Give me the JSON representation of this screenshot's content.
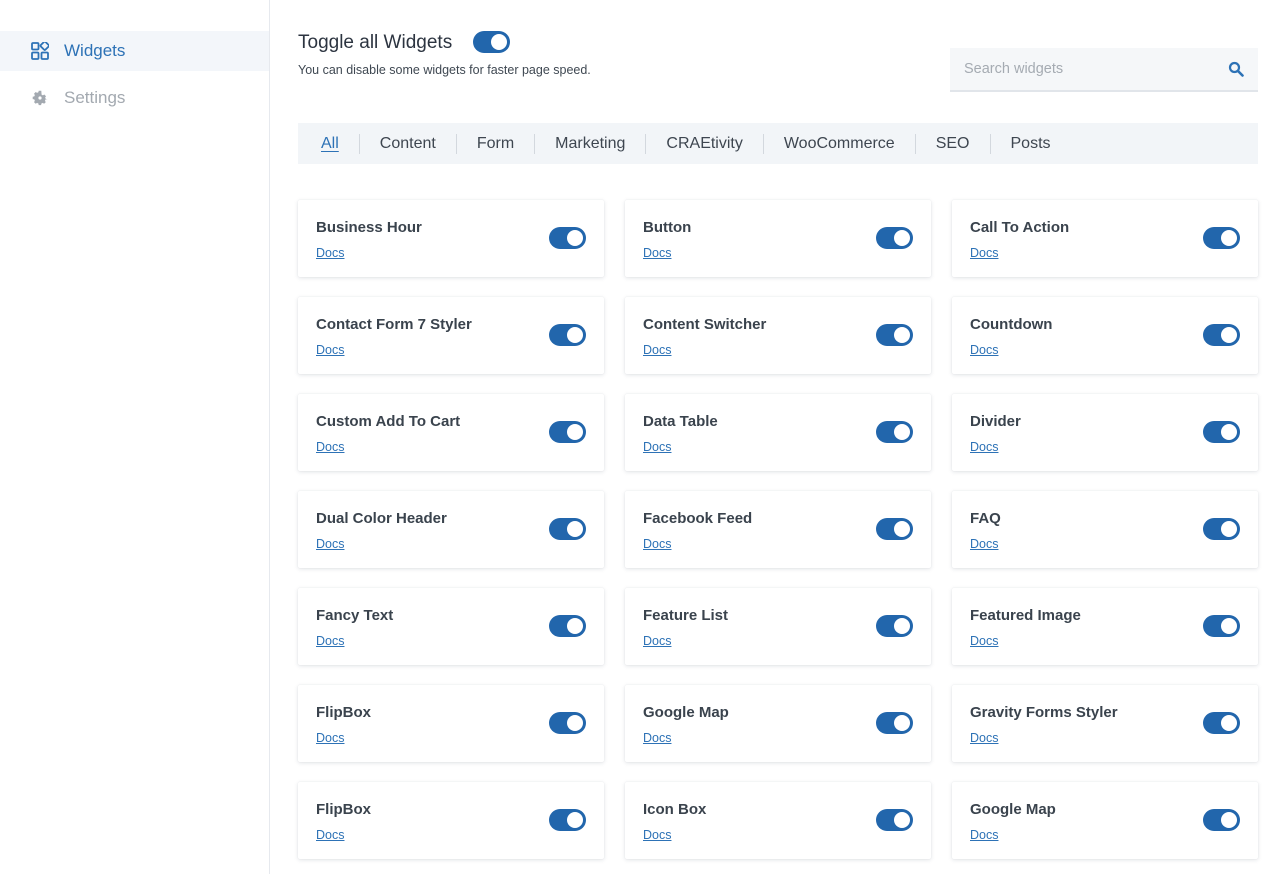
{
  "sidebar": {
    "items": [
      {
        "label": "Widgets",
        "icon": "widgets-grid-icon",
        "active": true
      },
      {
        "label": "Settings",
        "icon": "gear-icon",
        "active": false
      }
    ]
  },
  "header": {
    "title": "Toggle all Widgets",
    "toggle_all_on": true,
    "subtitle": "You can disable some widgets for faster page speed."
  },
  "search": {
    "placeholder": "Search widgets",
    "value": ""
  },
  "tabs": [
    "All",
    "Content",
    "Form",
    "Marketing",
    "CRAEtivity",
    "WooCommerce",
    "SEO",
    "Posts"
  ],
  "active_tab": "All",
  "widgets": [
    {
      "name": "Business Hour",
      "docs": "Docs",
      "enabled": true
    },
    {
      "name": "Button",
      "docs": "Docs",
      "enabled": true
    },
    {
      "name": "Call To Action",
      "docs": "Docs",
      "enabled": true
    },
    {
      "name": "Contact Form 7 Styler",
      "docs": "Docs",
      "enabled": true
    },
    {
      "name": "Content Switcher",
      "docs": "Docs",
      "enabled": true
    },
    {
      "name": "Countdown",
      "docs": "Docs",
      "enabled": true
    },
    {
      "name": "Custom Add To Cart",
      "docs": "Docs",
      "enabled": true
    },
    {
      "name": "Data Table",
      "docs": "Docs",
      "enabled": true
    },
    {
      "name": "Divider",
      "docs": "Docs",
      "enabled": true
    },
    {
      "name": "Dual Color Header",
      "docs": "Docs",
      "enabled": true
    },
    {
      "name": "Facebook Feed",
      "docs": "Docs",
      "enabled": true
    },
    {
      "name": "FAQ",
      "docs": "Docs",
      "enabled": true
    },
    {
      "name": "Fancy Text",
      "docs": "Docs",
      "enabled": true
    },
    {
      "name": "Feature List",
      "docs": "Docs",
      "enabled": true
    },
    {
      "name": "Featured Image",
      "docs": "Docs",
      "enabled": true
    },
    {
      "name": "FlipBox",
      "docs": "Docs",
      "enabled": true
    },
    {
      "name": "Google Map",
      "docs": "Docs",
      "enabled": true
    },
    {
      "name": "Gravity Forms Styler",
      "docs": "Docs",
      "enabled": true
    },
    {
      "name": "FlipBox",
      "docs": "Docs",
      "enabled": true
    },
    {
      "name": "Icon Box",
      "docs": "Docs",
      "enabled": true
    },
    {
      "name": "Google Map",
      "docs": "Docs",
      "enabled": true
    }
  ],
  "colors": {
    "accent": "#2d72b6",
    "toggle_on": "#2266ac",
    "sidebar_active_bg": "#f3f6fa",
    "tabs_bg": "#f2f5f8"
  }
}
